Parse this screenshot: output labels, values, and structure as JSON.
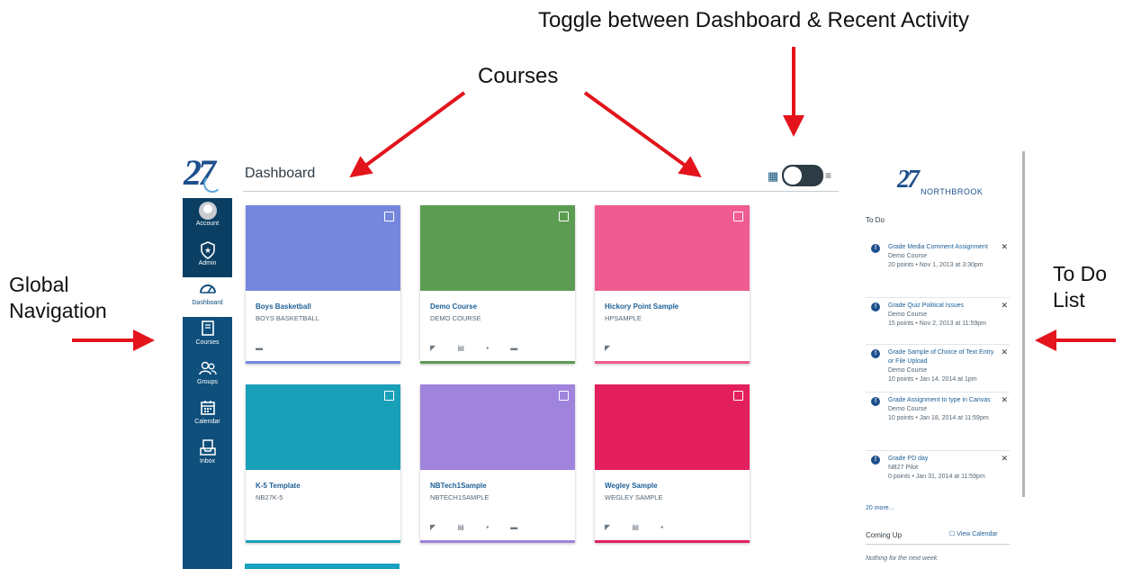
{
  "annotations": {
    "toggle": "Toggle between Dashboard & Recent Activity",
    "courses": "Courses",
    "global_nav_line1": "Global",
    "global_nav_line2": "Navigation",
    "todo_line1": "To Do",
    "todo_line2": "List"
  },
  "colors": {
    "nav_bg": "#0e4f7c",
    "arrow": "#e3141c",
    "link": "#1e5f96"
  },
  "logo": {
    "text": "27"
  },
  "nav": {
    "items": [
      {
        "label": "Account",
        "icon": "avatar-icon"
      },
      {
        "label": "Admin",
        "icon": "shield-star-icon"
      },
      {
        "label": "Dashboard",
        "icon": "speedometer-icon"
      },
      {
        "label": "Courses",
        "icon": "book-icon"
      },
      {
        "label": "Groups",
        "icon": "people-icon"
      },
      {
        "label": "Calendar",
        "icon": "calendar-icon"
      },
      {
        "label": "Inbox",
        "icon": "inbox-icon"
      }
    ]
  },
  "header": {
    "title": "Dashboard"
  },
  "courses": [
    {
      "name": "Boys Basketball",
      "code": "BOYS BASKETBALL",
      "color": "#7587dd",
      "icons": [
        "folder-icon"
      ]
    },
    {
      "name": "Demo Course",
      "code": "DEMO COURSE",
      "color": "#5c9c52",
      "icons": [
        "announcement-icon",
        "assignment-icon",
        "discussion-icon",
        "folder-icon"
      ]
    },
    {
      "name": "Hickory Point Sample",
      "code": "HPSAMPLE",
      "color": "#f05c92",
      "icons": [
        "announcement-icon"
      ]
    },
    {
      "name": "K-5 Template",
      "code": "NB27K-5",
      "color": "#1a9fb8",
      "icons": []
    },
    {
      "name": "NBTech1Sample",
      "code": "NBTECH1SAMPLE",
      "color": "#a083dd",
      "icons": [
        "announcement-icon",
        "assignment-icon",
        "discussion-icon",
        "folder-icon"
      ]
    },
    {
      "name": "Wegley Sample",
      "code": "WEGLEY SAMPLE",
      "color": "#e41f5e",
      "icons": [
        "announcement-icon",
        "assignment-icon",
        "discussion-icon"
      ]
    }
  ],
  "sidebar": {
    "logo_num": "27",
    "logo_text": "NORTHBROOK",
    "todo_title": "To Do",
    "todos": [
      {
        "title": "Grade Media Comment Assignment",
        "course": "Demo Course",
        "meta": "20 points • Nov 1, 2013 at 3:30pm"
      },
      {
        "title": "Grade Quiz Political Issues",
        "course": "Demo Course",
        "meta": "15 points • Nov 2, 2013 at 11:59pm"
      },
      {
        "title": "Grade Sample of Choice of Text Entry or File Upload",
        "course": "Demo Course",
        "meta": "10 points • Jan 14, 2014 at 1pm"
      },
      {
        "title": "Grade Assignment to type in Canvas",
        "course": "Demo Course",
        "meta": "10 points • Jan 18, 2014 at 11:59pm"
      },
      {
        "title": "Grade PD day",
        "course": "NB27 Pilot",
        "meta": "0 points • Jan 31, 2014 at 11:59pm"
      }
    ],
    "more": "20 more...",
    "coming_up": "Coming Up",
    "view_calendar": "View Calendar",
    "nothing": "Nothing for the next week"
  }
}
